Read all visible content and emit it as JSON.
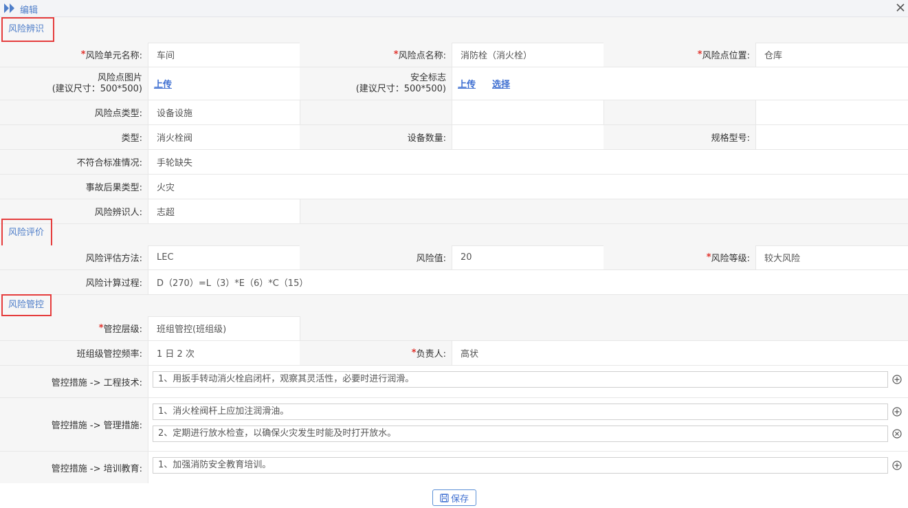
{
  "window": {
    "title": "编辑"
  },
  "sections": {
    "identify": "风险辨识",
    "evaluate": "风险评价",
    "control": "风险管控"
  },
  "identify": {
    "unit_name_label": "风险单元名称:",
    "unit_name": "车间",
    "point_name_label": "风险点名称:",
    "point_name": "消防栓（消火栓）",
    "point_location_label": "风险点位置:",
    "point_location": "仓库",
    "point_image_label": "风险点图片",
    "point_image_hint": "(建议尺寸：500*500)",
    "upload": "上传",
    "safety_sign_label": "安全标志",
    "safety_sign_hint": "(建议尺寸：500*500)",
    "select": "选择",
    "point_type_label": "风险点类型:",
    "point_type": "设备设施",
    "type_label": "类型:",
    "type": "消火栓阀",
    "equipment_count_label": "设备数量:",
    "equipment_count": "",
    "spec_label": "规格型号:",
    "spec": "",
    "nonconformity_label": "不符合标准情况:",
    "nonconformity": "手轮缺失",
    "consequence_label": "事故后果类型:",
    "consequence": "火灾",
    "identifier_label": "风险辨识人:",
    "identifier": "志超"
  },
  "evaluate": {
    "method_label": "风险评估方法:",
    "method": "LEC",
    "value_label": "风险值:",
    "value": "20",
    "level_label": "风险等级:",
    "level": "较大风险",
    "calc_label": "风险计算过程:",
    "calc": "D（270）=L（3）*E（6）*C（15）"
  },
  "control": {
    "control_level_label": "管控层级:",
    "control_level": "班组管控(班组级)",
    "frequency_label": "班组级管控频率:",
    "frequency": "1 日 2 次",
    "owner_label": "负责人:",
    "owner": "高状",
    "engineering_label": "管控措施 -> 工程技术:",
    "engineering": [
      "1、用扳手转动消火栓启闭杆，观察其灵活性，必要时进行润滑。"
    ],
    "management_label": "管控措施 -> 管理措施:",
    "management": [
      "1、消火栓阀杆上应加注润滑油。",
      "2、定期进行放水检查，以确保火灾发生时能及时打开放水。"
    ],
    "training_label": "管控措施 -> 培训教育:",
    "training": [
      "1、加强消防安全教育培训。"
    ]
  },
  "required_mark": "*",
  "save_label": "保存",
  "colors": {
    "accent": "#4f7ec9",
    "required": "#e0312b",
    "highlight_border": "#e53c3c"
  }
}
